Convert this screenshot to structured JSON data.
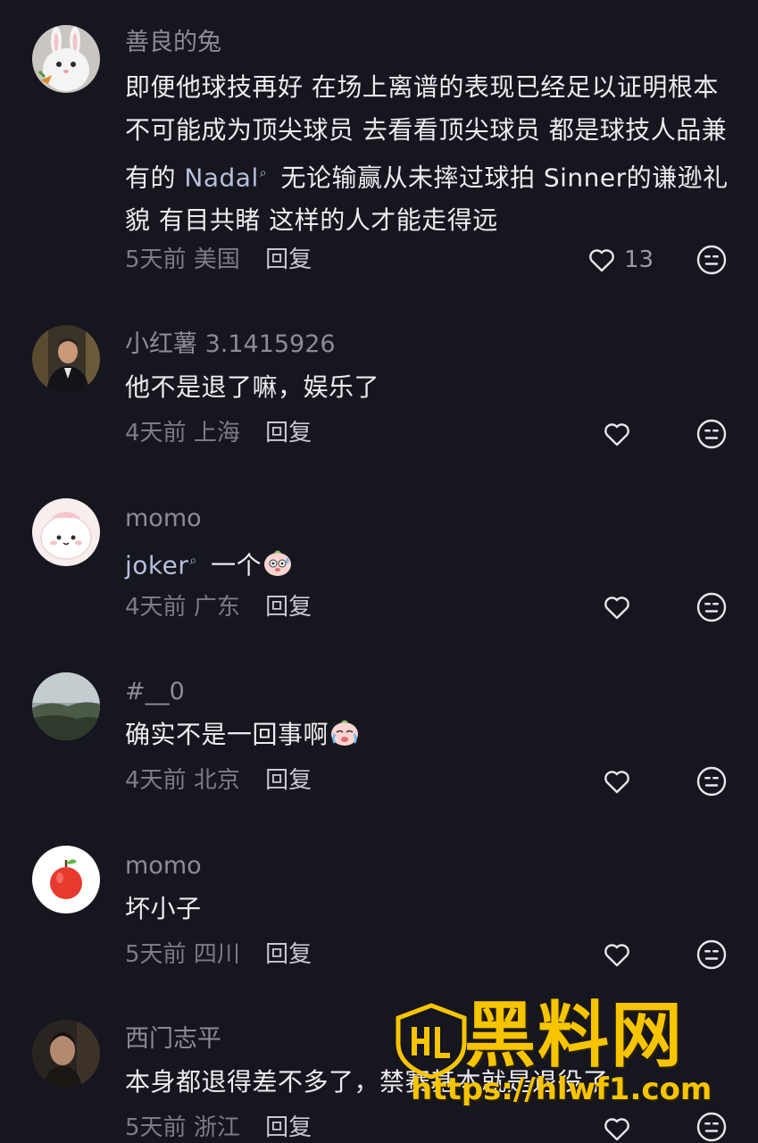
{
  "comments": [
    {
      "username": "善良的兔",
      "text_before": "即便他球技再好 在场上离谱的表现已经足以证明根本不可能成为顶尖球员 去看看顶尖球员 都是球技人品兼有的 ",
      "mention": "Nadal",
      "text_after": " 无论输赢从未摔过球拍 Sinner的谦逊礼貌 有目共睹 这样的人才能走得远",
      "time": "5天前",
      "location": "美国",
      "reply_label": "回复",
      "likes": "13"
    },
    {
      "username": "小红薯 3.1415926",
      "text": "他不是退了嘛，娱乐了",
      "time": "4天前",
      "location": "上海",
      "reply_label": "回复"
    },
    {
      "username": "momo",
      "mention": "joker",
      "text_after": " 一个",
      "time": "4天前",
      "location": "广东",
      "reply_label": "回复"
    },
    {
      "username": "#__0",
      "text": "确实不是一回事啊",
      "time": "4天前",
      "location": "北京",
      "reply_label": "回复"
    },
    {
      "username": "momo",
      "text": "坏小子",
      "time": "5天前",
      "location": "四川",
      "reply_label": "回复"
    },
    {
      "username": "西门志平",
      "text": "本身都退得差不多了，禁赛基本就是退役了",
      "time": "5天前",
      "location": "浙江",
      "reply_label": "回复"
    }
  ],
  "icons": {
    "like": "heart-outline-icon",
    "react": "meh-face-icon",
    "mention": "search-icon"
  },
  "colors": {
    "background": "#16161e",
    "mention": "#b6bfde",
    "watermark": "#f6c400"
  },
  "watermark": {
    "logo_text": "HL",
    "title": "黑料网",
    "url": "https://hlwf1.com"
  }
}
